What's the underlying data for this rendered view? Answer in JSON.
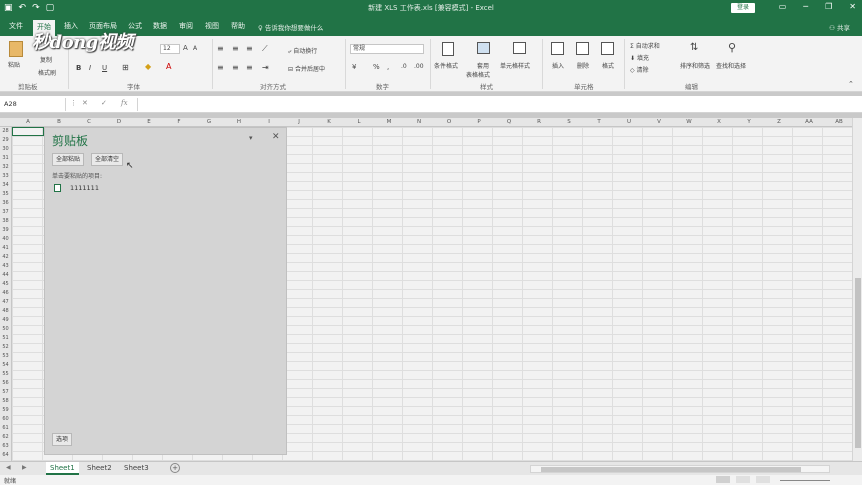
{
  "titlebar": {
    "title": "新建 XLS 工作表.xls [兼容模式] - Excel",
    "login_label": "登录",
    "qat": {
      "save_icon": "save-icon",
      "undo_icon": "undo-icon",
      "redo_icon": "redo-icon",
      "new_icon": "new-file-icon"
    }
  },
  "tabs": {
    "items": [
      "文件",
      "开始",
      "插入",
      "页面布局",
      "公式",
      "数据",
      "审阅",
      "视图",
      "帮助"
    ],
    "tellme": "告诉我你想要做什么",
    "share": "共享"
  },
  "ribbon": {
    "clipboard": {
      "paste": "粘贴",
      "copy": "复制",
      "format_painter": "格式刷",
      "label": "剪贴板"
    },
    "font": {
      "size": "12",
      "label": "字体",
      "bold": "B",
      "italic": "I",
      "underline": "U"
    },
    "alignment": {
      "wrap": "自动换行",
      "merge": "合并后居中",
      "label": "对齐方式"
    },
    "number": {
      "format": "常规",
      "label": "数字"
    },
    "styles": {
      "conditional": "条件格式",
      "table_format_1": "套用",
      "table_format_2": "表格格式",
      "cell_styles": "单元格样式",
      "label": "样式"
    },
    "cells": {
      "insert": "插入",
      "delete": "删除",
      "format": "格式",
      "label": "单元格"
    },
    "editing": {
      "autosum": "自动求和",
      "fill": "填充",
      "clear": "清除",
      "sort": "排序和筛选",
      "find": "查找和选择",
      "label": "编辑"
    }
  },
  "logo_text": "秒dong视频",
  "formula_bar": {
    "name_box": "A28",
    "fx": "fx"
  },
  "grid": {
    "columns": [
      "A",
      "B",
      "C",
      "D",
      "E",
      "F",
      "G",
      "H",
      "I",
      "J",
      "K",
      "L",
      "M",
      "N",
      "O",
      "P",
      "Q",
      "R",
      "S",
      "T",
      "U",
      "V",
      "W",
      "X",
      "Y",
      "Z",
      "AA",
      "AB"
    ],
    "rows": [
      "28",
      "29",
      "30",
      "31",
      "32",
      "33",
      "34",
      "35",
      "36",
      "37",
      "38",
      "39",
      "40",
      "41",
      "42",
      "43",
      "44",
      "45",
      "46",
      "47",
      "48",
      "49",
      "50",
      "51",
      "52",
      "53",
      "54",
      "55",
      "56",
      "57",
      "58",
      "59",
      "60",
      "61",
      "62",
      "63",
      "64",
      "65"
    ]
  },
  "clipboard_pane": {
    "title": "剪贴板",
    "paste_all": "全部粘贴",
    "clear_all": "全部清空",
    "hint": "单击要粘贴的项目:",
    "items": [
      "1111111"
    ],
    "options": "选项"
  },
  "sheets": [
    "Sheet1",
    "Sheet2",
    "Sheet3"
  ],
  "status": {
    "ready": "就绪"
  },
  "colors": {
    "accent": "#217346"
  }
}
